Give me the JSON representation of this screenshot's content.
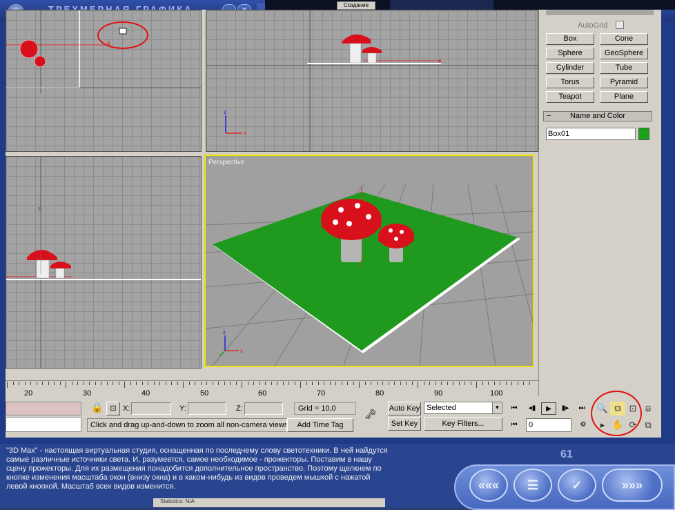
{
  "window": {
    "title": "ТРЕХМЕРНАЯ ГРАФИКА",
    "top_fragment": "Создание"
  },
  "viewports": {
    "perspective_label": "Perspective"
  },
  "command_panel": {
    "autogrid_label": "AutoGrid",
    "primitives": [
      "Box",
      "Cone",
      "Sphere",
      "GeoSphere",
      "Cylinder",
      "Tube",
      "Torus",
      "Pyramid",
      "Teapot",
      "Plane"
    ],
    "name_color_title": "Name and Color",
    "name_value": "Box01",
    "object_color": "#1aa31a"
  },
  "timeline": {
    "ruler_numbers": [
      "20",
      "30",
      "40",
      "50",
      "60",
      "70",
      "80",
      "90",
      "100"
    ]
  },
  "status_bar": {
    "x_label": "X:",
    "y_label": "Y:",
    "z_label": "Z:",
    "grid_label": "Grid = 10,0",
    "prompt": "Click and drag up-and-down to zoom all non-camera views i",
    "add_time_tag": "Add Time Tag",
    "auto_key": "Auto Key",
    "set_key": "Set Key",
    "selected": "Selected",
    "key_filters": "Key Filters...",
    "frame": "0"
  },
  "lesson": {
    "text": "\"3D Max\" - настоящая виртуальная студия, оснащенная по последнему слову светотехники. В ней найдутся\nсамые различные источники света. И, разумеется, самое необходимое - прожекторы. Поставим в нашу\nсцену прожекторы. Для их размещения понадобится дополнительное пространство. Поэтому щелкнем по\nкнопке изменения масштаба окон (внизу окна) и в каком-нибудь из видов проведем мышкой с нажатой\nлевой кнопкой. Масштаб всех видов изменится.",
    "page_number": "61",
    "statistics": "Statistics: N/A"
  },
  "colors": {
    "ground": "#1f9a1f",
    "mushroom_cap": "#d8101c",
    "highlight_circle": "#e01010",
    "active_viewport_border": "#f0e400"
  }
}
